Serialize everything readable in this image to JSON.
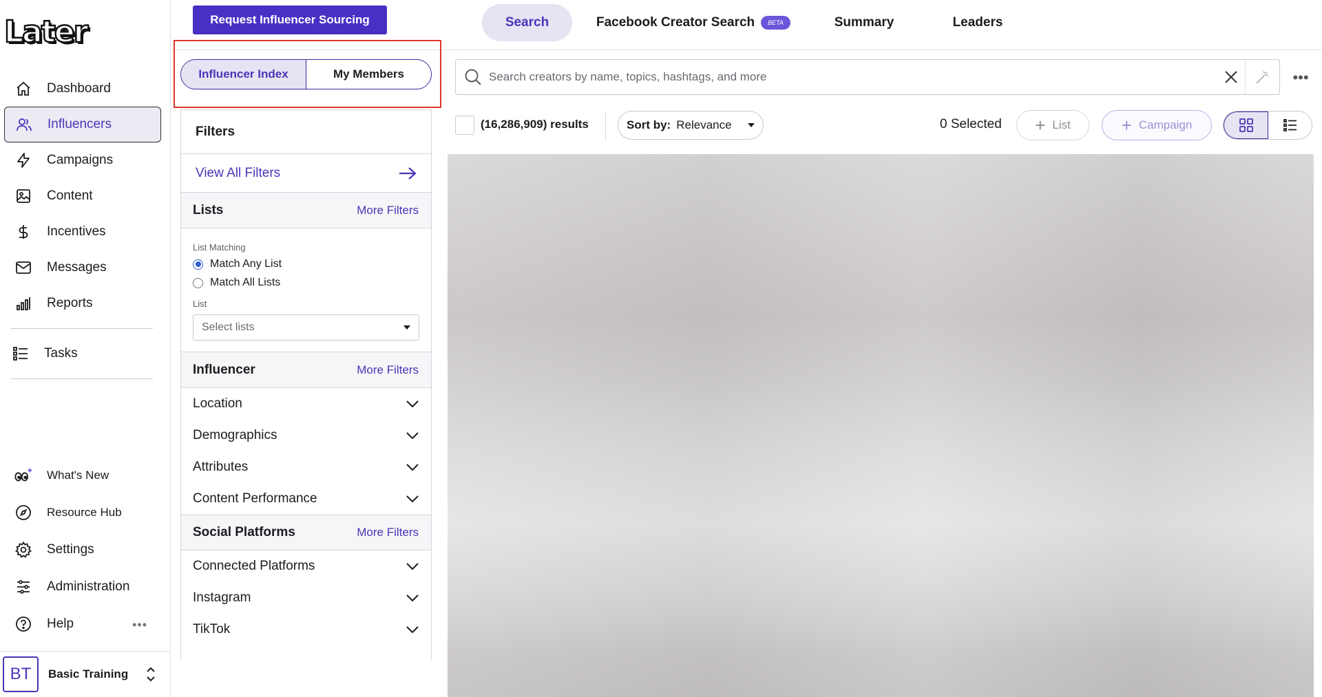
{
  "brand": {
    "logo_text": "Later"
  },
  "sidebar": {
    "items": [
      {
        "label": "Dashboard",
        "icon": "home-icon"
      },
      {
        "label": "Influencers",
        "icon": "users-icon",
        "active": true
      },
      {
        "label": "Campaigns",
        "icon": "lightning-icon"
      },
      {
        "label": "Content",
        "icon": "image-icon"
      },
      {
        "label": "Incentives",
        "icon": "dollar-icon"
      },
      {
        "label": "Messages",
        "icon": "mail-icon"
      },
      {
        "label": "Reports",
        "icon": "bar-chart-icon"
      }
    ],
    "tasks": {
      "label": "Tasks",
      "icon": "list-icon"
    },
    "bottom_items": [
      {
        "label": "What's New",
        "icon": "sparkle-eyes-icon"
      },
      {
        "label": "Resource Hub",
        "icon": "compass-icon"
      },
      {
        "label": "Settings",
        "icon": "gear-icon"
      },
      {
        "label": "Administration",
        "icon": "sliders-icon"
      },
      {
        "label": "Help",
        "icon": "help-circle-icon"
      }
    ],
    "help_more": "•••",
    "account": {
      "initials": "BT",
      "name": "Basic Training"
    }
  },
  "topbar": {
    "request_button": "Request Influencer Sourcing",
    "tabs": [
      {
        "label": "Search",
        "active": true
      },
      {
        "label": "Facebook Creator Search",
        "badge": "BETA"
      },
      {
        "label": "Summary"
      },
      {
        "label": "Leaders"
      }
    ]
  },
  "segment": {
    "left": "Influencer Index",
    "right": "My Members"
  },
  "filters": {
    "title": "Filters",
    "view_all": "View All Filters",
    "more_filters": "More Filters",
    "lists": {
      "name": "Lists",
      "matching_label": "List Matching",
      "options": [
        "Match Any List",
        "Match All Lists"
      ],
      "list_label": "List",
      "select_placeholder": "Select lists"
    },
    "influencer": {
      "name": "Influencer",
      "rows": [
        "Location",
        "Demographics",
        "Attributes",
        "Content Performance"
      ]
    },
    "social": {
      "name": "Social Platforms",
      "rows": [
        "Connected Platforms",
        "Instagram",
        "TikTok"
      ]
    }
  },
  "results": {
    "search_placeholder": "Search creators by name, topics, hashtags, and more",
    "count": "(16,286,909) results",
    "sort_label": "Sort by:",
    "sort_value": "Relevance",
    "selected": "0 Selected",
    "list_button": "List",
    "campaign_button": "Campaign",
    "more": "•••"
  },
  "colors": {
    "accent": "#4a35b8",
    "primary_button": "#4a2fc4",
    "highlight_box": "#e0362a"
  }
}
